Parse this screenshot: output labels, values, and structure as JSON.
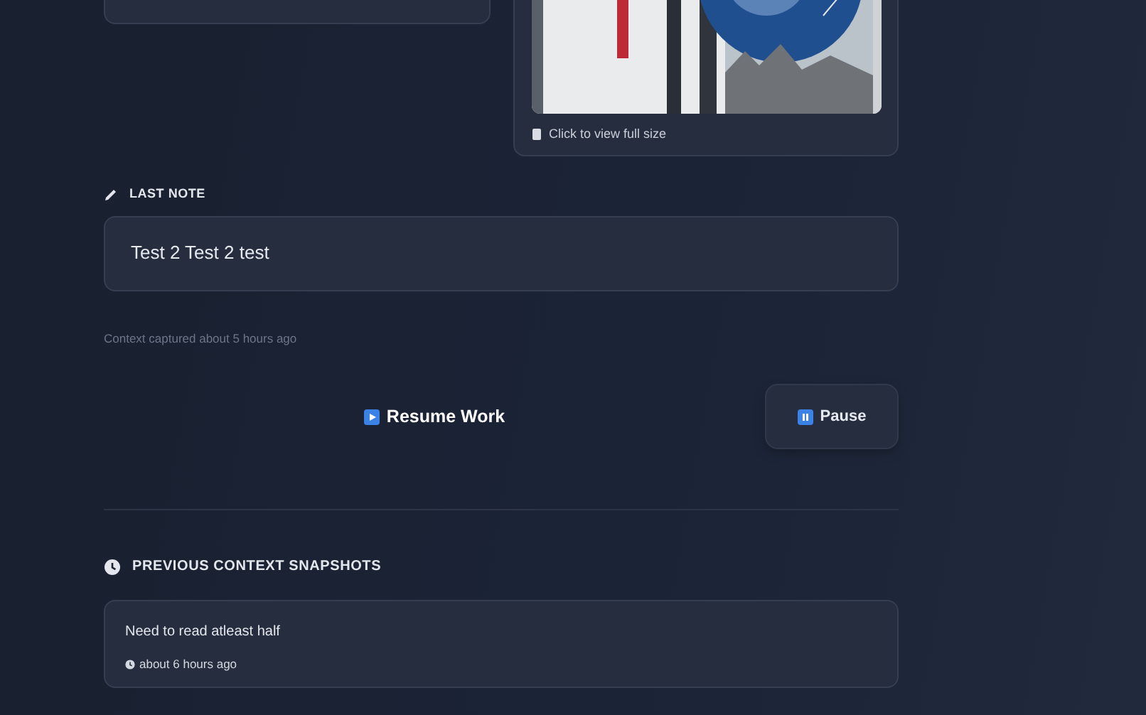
{
  "attachment": {
    "caption": "Click to view full size"
  },
  "last_note": {
    "label": "LAST NOTE",
    "text": "Test 2 Test 2 test"
  },
  "captured": "Context captured about 5 hours ago",
  "actions": [
    {
      "kind": "primary",
      "label": "Resume Work"
    },
    {
      "kind": "secondary",
      "label": "Pause"
    }
  ],
  "previous": {
    "title": "PREVIOUS CONTEXT SNAPSHOTS",
    "snapshots": [
      {
        "text": "Need to read atleast half",
        "time": "about 6 hours ago"
      }
    ]
  }
}
